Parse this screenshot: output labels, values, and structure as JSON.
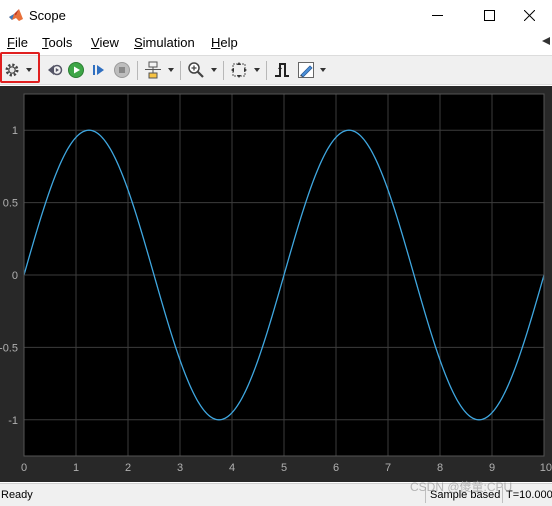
{
  "window": {
    "title": "Scope",
    "minimize_icon": "minimize-icon",
    "maximize_icon": "maximize-icon",
    "close_icon": "close-icon"
  },
  "menu": {
    "items": [
      {
        "label": "File",
        "mnemonic": "F",
        "rest": "ile"
      },
      {
        "label": "Tools",
        "mnemonic": "T",
        "rest": "ools"
      },
      {
        "label": "View",
        "mnemonic": "V",
        "rest": "iew"
      },
      {
        "label": "Simulation",
        "mnemonic": "S",
        "rest": "imulation"
      },
      {
        "label": "Help",
        "mnemonic": "H",
        "rest": "elp"
      }
    ]
  },
  "toolbar": {
    "buttons": [
      {
        "name": "configuration-properties",
        "icon": "gear-icon",
        "dropdown": true
      },
      {
        "name": "step-back",
        "icon": "step-back-icon",
        "dropdown": false
      },
      {
        "name": "run",
        "icon": "run-icon",
        "dropdown": false
      },
      {
        "name": "step-forward",
        "icon": "step-forward-icon",
        "dropdown": false
      },
      {
        "name": "stop",
        "icon": "stop-icon",
        "dropdown": false
      },
      {
        "name": "highlight-simulink-block",
        "icon": "block-icon",
        "dropdown": true
      },
      {
        "name": "zoom",
        "icon": "zoom-in-icon",
        "dropdown": true
      },
      {
        "name": "autoscale",
        "icon": "autoscale-icon",
        "dropdown": true
      },
      {
        "name": "triggers",
        "icon": "trigger-icon",
        "dropdown": false
      },
      {
        "name": "style",
        "icon": "style-icon",
        "dropdown": true
      }
    ],
    "highlight_color": "#e02020"
  },
  "chart_data": {
    "type": "line",
    "title": "",
    "xlabel": "",
    "ylabel": "",
    "xlim": [
      0,
      10
    ],
    "ylim": [
      -1.25,
      1.25
    ],
    "xticks": [
      0,
      1,
      2,
      3,
      4,
      5,
      6,
      7,
      8,
      9,
      10
    ],
    "yticks": [
      -1,
      -0.5,
      0,
      0.5,
      1
    ],
    "xtick_labels": [
      "0",
      "1",
      "2",
      "3",
      "4",
      "5",
      "6",
      "7",
      "8",
      "9",
      "10"
    ],
    "ytick_labels": [
      "-1",
      "-0.5",
      "0",
      "0.5",
      "1"
    ],
    "grid": true,
    "background": "#000000",
    "axes_color": "#b0b0b0",
    "series": [
      {
        "function": "sin(2*pi*x/5)",
        "color": "#3fa7e0",
        "x": [
          0,
          0.25,
          0.5,
          0.75,
          1,
          1.25,
          1.5,
          1.75,
          2,
          2.25,
          2.5,
          2.75,
          3,
          3.25,
          3.5,
          3.75,
          4,
          4.25,
          4.5,
          4.75,
          5,
          5.25,
          5.5,
          5.75,
          6,
          6.25,
          6.5,
          6.75,
          7,
          7.25,
          7.5,
          7.75,
          8,
          8.25,
          8.5,
          8.75,
          9,
          9.25,
          9.5,
          9.75,
          10
        ],
        "y": [
          0,
          0.309,
          0.588,
          0.809,
          0.951,
          1,
          0.951,
          0.809,
          0.588,
          0.309,
          0,
          -0.309,
          -0.588,
          -0.809,
          -0.951,
          -1,
          -0.951,
          -0.809,
          -0.588,
          -0.309,
          0,
          0.309,
          0.588,
          0.809,
          0.951,
          1,
          0.951,
          0.809,
          0.588,
          0.309,
          0,
          -0.309,
          -0.588,
          -0.809,
          -0.951,
          -1,
          -0.951,
          -0.809,
          -0.588,
          -0.309,
          0
        ]
      }
    ]
  },
  "status": {
    "ready": "Ready",
    "mode": "Sample based",
    "time": "T=10.000"
  },
  "watermark": "CSDN @傻童:CPU"
}
